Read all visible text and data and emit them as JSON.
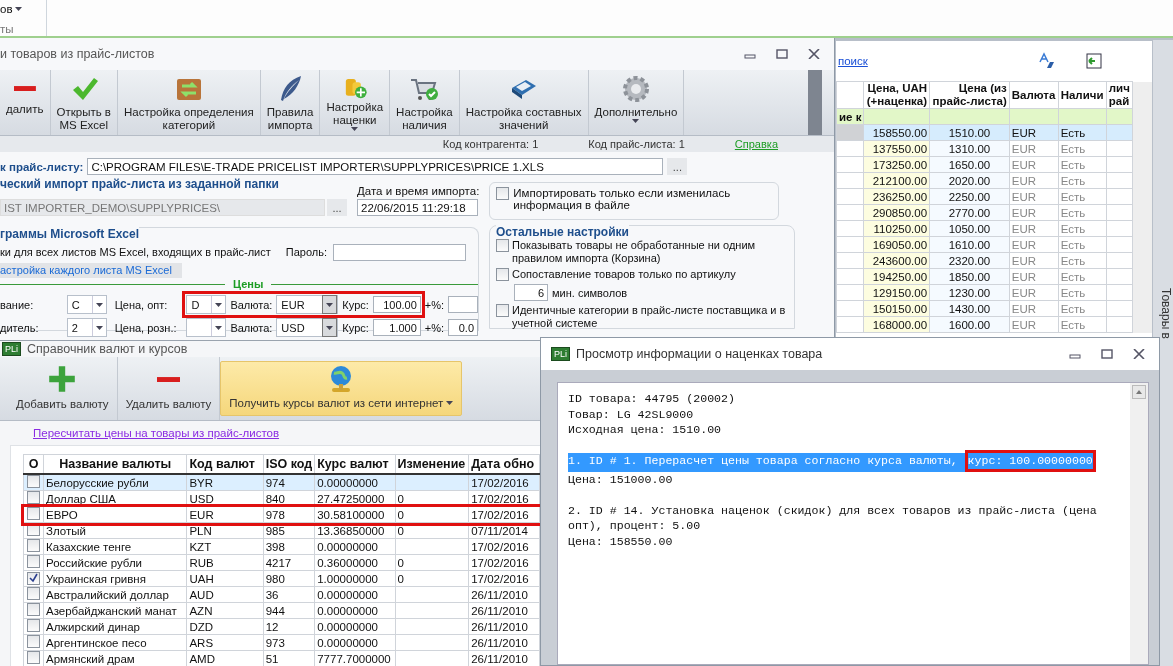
{
  "background_app": {
    "menu_fragment": "ов",
    "group_fragment": "ты"
  },
  "import_window": {
    "title": "и товаров из прайс-листов",
    "toolbar": [
      {
        "label": "далить",
        "menu": false
      },
      {
        "label": "Открыть в\nMS Excel",
        "menu": false
      },
      {
        "label": "Настройка определения\nкатегорий",
        "menu": false
      },
      {
        "label": "Правила\nимпорта",
        "menu": false
      },
      {
        "label": "Настройка\nнаценки",
        "menu": true
      },
      {
        "label": "Настройка\nналичия",
        "menu": false
      },
      {
        "label": "Настройка составных\nзначений",
        "menu": false
      },
      {
        "label": "Дополнительно",
        "menu": true
      }
    ],
    "status": {
      "contractor_code": "Код контрагента: 1",
      "pricelist_code": "Код прайс-листа: 1",
      "help_link": "Справка"
    },
    "path_label": "к прайс-листу:",
    "path_value": "C:\\PROGRAM FILES\\E-TRADE PRICELIST IMPORTER\\SUPPLYPRICES\\PRICE 1.XLS",
    "path_browse": "...",
    "auto_import": {
      "title": "ческий импорт прайс-листа из заданной папки",
      "folder": "IST IMPORTER_DEMO\\SUPPLYPRICES\\",
      "folder_browse": "...",
      "date_label": "Дата и время импорта:",
      "date_value": "22/06/2015 11:29:18",
      "only_if_changed": {
        "label": "Импортировать только если изменилась информация в файле",
        "checked": false
      }
    },
    "excel": {
      "title": "граммы Microsoft Excel",
      "all_sheets": "ки для всех листов MS Excel, входящих в прайс-лист",
      "password_label": "Пароль:",
      "each_sheet": "астройка каждого листа MS Excel",
      "prices_heading": "Цены",
      "rows": [
        {
          "label": "вание:",
          "column": "C",
          "price_label": "Цена, опт:",
          "price_column": "D",
          "currency_label": "Валюта:",
          "currency": "EUR",
          "rate_label": "Курс:",
          "rate": "100.00",
          "percent_label": "+%:",
          "highlighted": true
        },
        {
          "label": "дитель:",
          "column": "2",
          "price_label": "Цена, розн.:",
          "currency_label": "Валюта:",
          "currency": "USD",
          "rate_label": "Курс:",
          "rate": "1.000",
          "percent_label": "+%:",
          "percent": "0.0",
          "highlighted": false
        }
      ]
    },
    "other_settings": {
      "title": "Остальные настройки",
      "options": [
        {
          "kind": "checkbox",
          "label": "Показывать товары не обработанные ни одним правилом импорта (Корзина)",
          "checked": false
        },
        {
          "kind": "checkbox",
          "label": "Сопоставление товаров только по артикулу",
          "checked": false,
          "min_chars": {
            "value": "6",
            "label": "мин. символов"
          }
        },
        {
          "kind": "checkbox",
          "label": "Идентичные категории в прайс-листе поставщика и в учетной системе",
          "checked": false
        }
      ]
    }
  },
  "results_window": {
    "search_link": "поиск",
    "side_tab": "Товары в",
    "columns": [
      "Цена, UAH\n(+наценка)",
      "Цена (из\nпрайс-листа)",
      "Валюта",
      "Наличи",
      "лич\nрай"
    ],
    "filter_text": "ие к",
    "rows": [
      {
        "price_uah": "158550.00",
        "price_list": "1510.00",
        "currency": "EUR",
        "availability": "Есть",
        "selected": true
      },
      {
        "price_uah": "137550.00",
        "price_list": "1310.00",
        "currency": "EUR",
        "availability": "Есть",
        "selected": false
      },
      {
        "price_uah": "173250.00",
        "price_list": "1650.00",
        "currency": "EUR",
        "availability": "Есть",
        "selected": false
      },
      {
        "price_uah": "212100.00",
        "price_list": "2020.00",
        "currency": "EUR",
        "availability": "Есть",
        "selected": false
      },
      {
        "price_uah": "236250.00",
        "price_list": "2250.00",
        "currency": "EUR",
        "availability": "Есть",
        "selected": false
      },
      {
        "price_uah": "290850.00",
        "price_list": "2770.00",
        "currency": "EUR",
        "availability": "Есть",
        "selected": false
      },
      {
        "price_uah": "110250.00",
        "price_list": "1050.00",
        "currency": "EUR",
        "availability": "Есть",
        "selected": false
      },
      {
        "price_uah": "169050.00",
        "price_list": "1610.00",
        "currency": "EUR",
        "availability": "Есть",
        "selected": false
      },
      {
        "price_uah": "243600.00",
        "price_list": "2320.00",
        "currency": "EUR",
        "availability": "Есть",
        "selected": false
      },
      {
        "price_uah": "194250.00",
        "price_list": "1850.00",
        "currency": "EUR",
        "availability": "Есть",
        "selected": false
      },
      {
        "price_uah": "129150.00",
        "price_list": "1230.00",
        "currency": "EUR",
        "availability": "Есть",
        "selected": false
      },
      {
        "price_uah": "150150.00",
        "price_list": "1430.00",
        "currency": "EUR",
        "availability": "Есть",
        "selected": false
      },
      {
        "price_uah": "168000.00",
        "price_list": "1600.00",
        "currency": "EUR",
        "availability": "Есть",
        "selected": false
      }
    ]
  },
  "currency_window": {
    "app_badge": "PLi",
    "title": "Справочник валют и курсов",
    "toolbar": [
      {
        "label": "Добавить валюту",
        "highlighted": false,
        "menu": false
      },
      {
        "label": "Удалить валюту",
        "highlighted": false,
        "menu": false
      },
      {
        "label": "Получить курсы валют из сети интернет",
        "highlighted": true,
        "menu": true
      }
    ],
    "recalc_link": "Пересчитать цены на товары из прайс-листов",
    "columns": [
      "О",
      "Название валюты",
      "Код валют",
      "ISO код",
      "Курс валют",
      "Изменение",
      "Дата обно"
    ],
    "rows": [
      {
        "checked": false,
        "name": "Белорусские рубли",
        "code": "BYR",
        "iso": "974",
        "rate": "0.00000000",
        "change": "",
        "date": "17/02/2016",
        "selected": true,
        "highlighted": false
      },
      {
        "checked": false,
        "name": "Доллар США",
        "code": "USD",
        "iso": "840",
        "rate": "27.47250000",
        "change": "0",
        "date": "17/02/2016",
        "selected": false,
        "highlighted": false
      },
      {
        "checked": false,
        "name": "ЕВРО",
        "code": "EUR",
        "iso": "978",
        "rate": "30.58100000",
        "change": "0",
        "date": "17/02/2016",
        "selected": false,
        "highlighted": true
      },
      {
        "checked": false,
        "name": "Злотый",
        "code": "PLN",
        "iso": "985",
        "rate": "13.36850000",
        "change": "0",
        "date": "07/11/2014",
        "selected": false,
        "highlighted": false
      },
      {
        "checked": false,
        "name": "Казахские тенге",
        "code": "KZT",
        "iso": "398",
        "rate": "0.00000000",
        "change": "",
        "date": "17/02/2016",
        "selected": false,
        "highlighted": false
      },
      {
        "checked": false,
        "name": "Российские рубли",
        "code": "RUB",
        "iso": "4217",
        "rate": "0.36000000",
        "change": "0",
        "date": "17/02/2016",
        "selected": false,
        "highlighted": false
      },
      {
        "checked": true,
        "name": "Украинская гривня",
        "code": "UAH",
        "iso": "980",
        "rate": "1.00000000",
        "change": "0",
        "date": "17/02/2016",
        "selected": false,
        "highlighted": false
      },
      {
        "checked": false,
        "name": "Австралийский доллар",
        "code": "AUD",
        "iso": "36",
        "rate": "0.00000000",
        "change": "",
        "date": "26/11/2010",
        "selected": false,
        "highlighted": false
      },
      {
        "checked": false,
        "name": "Азербайджанский манат",
        "code": "AZN",
        "iso": "944",
        "rate": "0.00000000",
        "change": "",
        "date": "26/11/2010",
        "selected": false,
        "highlighted": false
      },
      {
        "checked": false,
        "name": "Алжирский динар",
        "code": "DZD",
        "iso": "12",
        "rate": "0.00000000",
        "change": "",
        "date": "26/11/2010",
        "selected": false,
        "highlighted": false
      },
      {
        "checked": false,
        "name": "Аргентинское песо",
        "code": "ARS",
        "iso": "973",
        "rate": "0.00000000",
        "change": "",
        "date": "26/11/2010",
        "selected": false,
        "highlighted": false
      },
      {
        "checked": false,
        "name": "Армянский драм",
        "code": "AMD",
        "iso": "51",
        "rate": "7777.7000000",
        "change": "",
        "date": "26/11/2010",
        "selected": false,
        "highlighted": false
      }
    ]
  },
  "markup_window": {
    "app_badge": "PLi",
    "title": "Просмотр информации о наценках товара",
    "blocks": [
      [
        {
          "text": "ID товара: 44795 (20002)",
          "selected": false
        },
        {
          "text": "Товар: LG 42SL9000",
          "selected": false
        },
        {
          "text": "Исходная цена: 1510.00",
          "selected": false
        }
      ],
      [
        {
          "text": "1. ID # 1. Перерасчет цены товара согласно курса валюты,",
          "framed": "курс: 100.00000000",
          "selected": true
        },
        {
          "text": "Цена: 151000.00",
          "selected": false
        }
      ],
      [
        {
          "text": "2. ID # 14. Установка наценок (скидок) для всех товаров из прайс-листа (цена опт), процент: 5.00",
          "selected": false
        },
        {
          "text": "Цена: 158550.00",
          "selected": false
        }
      ]
    ]
  }
}
